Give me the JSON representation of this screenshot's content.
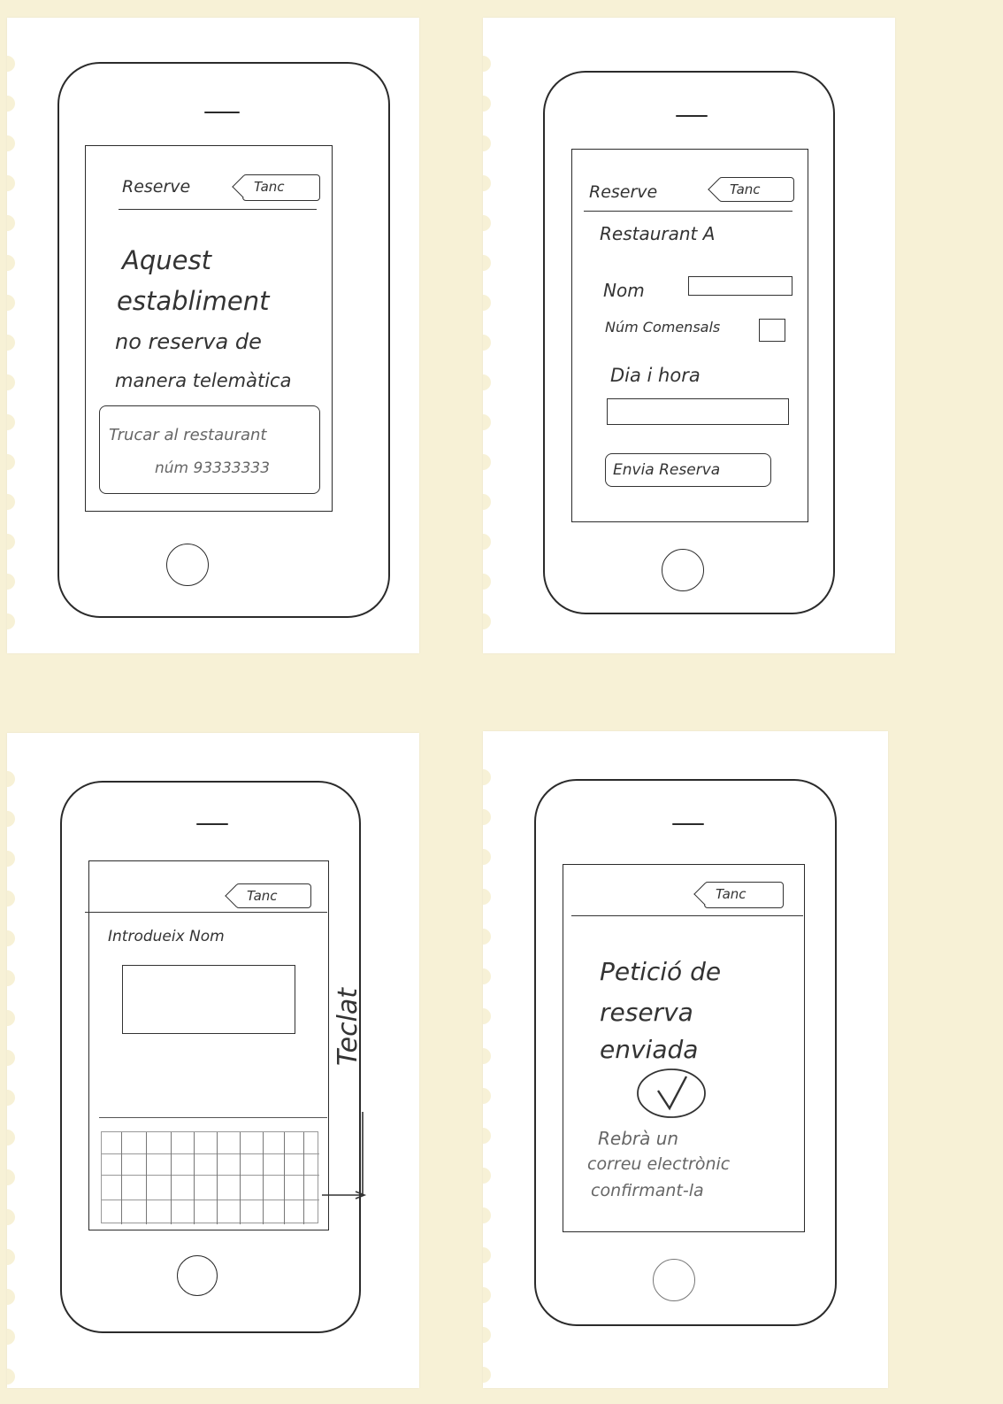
{
  "screens": [
    {
      "title": "Reserve",
      "back_label": "Tanc",
      "message_lines": [
        "Aquest",
        "establiment",
        "no reserva de",
        "manera telemàtica"
      ],
      "call_button": {
        "line1": "Trucar al restaurant",
        "line2": "núm 93333333"
      }
    },
    {
      "title": "Reserve",
      "back_label": "Tanc",
      "restaurant_label": "Restaurant A",
      "name_label": "Nom",
      "guests_label": "Núm Comensals",
      "datetime_label": "Dia i hora",
      "submit_label": "Envia Reserva"
    },
    {
      "back_label": "Tanc",
      "prompt": "Introdueix Nom",
      "keyboard_annotation": "Teclat"
    },
    {
      "back_label": "Tanc",
      "confirmation_lines": [
        "Petició de",
        "reserva",
        "enviada"
      ],
      "confirm_icon": "check-circle-icon",
      "note_lines": [
        "Rebrà un",
        "correu electrònic",
        "confirmant-la"
      ]
    }
  ]
}
